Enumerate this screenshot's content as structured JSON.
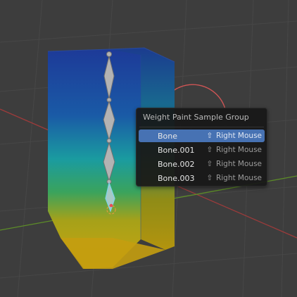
{
  "popup": {
    "title": "Weight Paint Sample Group",
    "items": [
      {
        "label": "Bone",
        "shortcut": "Right Mouse",
        "modifier_icon": "shift-icon",
        "active": true
      },
      {
        "label": "Bone.001",
        "shortcut": "Right Mouse",
        "modifier_icon": "shift-icon",
        "active": false
      },
      {
        "label": "Bone.002",
        "shortcut": "Right Mouse",
        "modifier_icon": "shift-icon",
        "active": false
      },
      {
        "label": "Bone.003",
        "shortcut": "Right Mouse",
        "modifier_icon": "shift-icon",
        "active": false
      }
    ]
  },
  "colors": {
    "viewport_bg": "#3d3d3d",
    "menu_highlight": "#4772b3",
    "x_axis": "#b04a4a",
    "y_axis": "#6a9a2a",
    "weight_low": "#1f3f9a",
    "weight_mid": "#1c9b9a",
    "weight_high": "#c59e12"
  }
}
